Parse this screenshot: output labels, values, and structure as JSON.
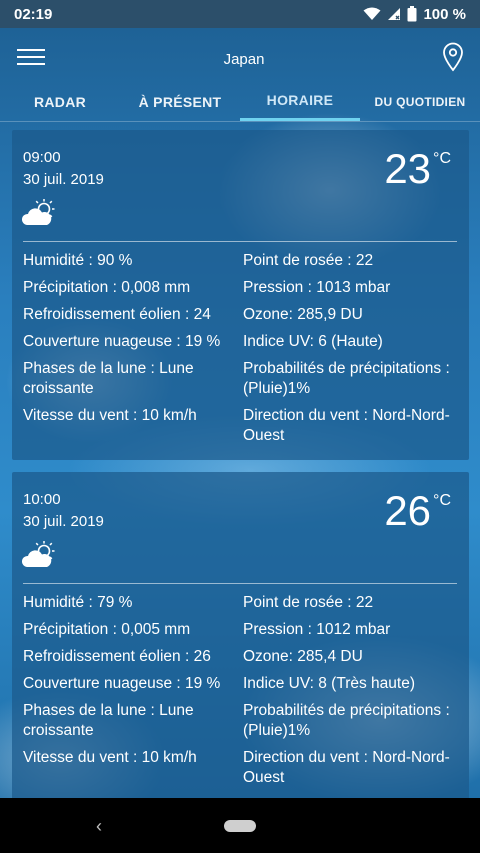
{
  "statusbar": {
    "time": "02:19",
    "battery": "100 %",
    "icons": [
      "wifi-icon",
      "signal-icon",
      "battery-icon"
    ]
  },
  "appbar": {
    "title": "Japan",
    "menu_icon": "hamburger-menu-icon",
    "location_icon": "location-pin-icon"
  },
  "tabs": [
    {
      "label": "RADAR",
      "active": false
    },
    {
      "label": "À PRÉSENT",
      "active": false
    },
    {
      "label": "HORAIRE",
      "active": true
    },
    {
      "label": "DU QUOTIDIEN",
      "active": false
    }
  ],
  "cards": [
    {
      "time": "09:00",
      "date": "30 juil. 2019",
      "temperature": "23",
      "unit": "°C",
      "icon": "partly-cloudy-icon",
      "left": [
        "Humidité : 90 %",
        "Précipitation : 0,008 mm",
        "Refroidissement éolien : 24",
        "Couverture nuageuse : 19 %",
        "Phases de la lune : Lune croissante",
        "Vitesse du vent : 10 km/h"
      ],
      "right": [
        "Point de rosée : 22",
        "Pression : 1013 mbar",
        "Ozone: 285,9 DU",
        "Indice UV: 6 (Haute)",
        "Probabilités de précipitations : (Pluie)1%",
        "Direction du vent : Nord-Nord-Ouest"
      ]
    },
    {
      "time": "10:00",
      "date": "30 juil. 2019",
      "temperature": "26",
      "unit": "°C",
      "icon": "partly-cloudy-icon",
      "left": [
        "Humidité : 79 %",
        "Précipitation : 0,005 mm",
        "Refroidissement éolien : 26",
        "Couverture nuageuse : 19 %",
        "Phases de la lune : Lune croissante",
        "Vitesse du vent : 10 km/h"
      ],
      "right": [
        "Point de rosée : 22",
        "Pression : 1012 mbar",
        "Ozone: 285,4 DU",
        "Indice UV: 8 (Très haute)",
        "Probabilités de précipitations : (Pluie)1%",
        "Direction du vent : Nord-Nord-Ouest"
      ]
    }
  ],
  "navbar": {
    "back_icon": "back-chevron-icon",
    "back_glyph": "‹",
    "home_icon": "home-pill-icon"
  }
}
